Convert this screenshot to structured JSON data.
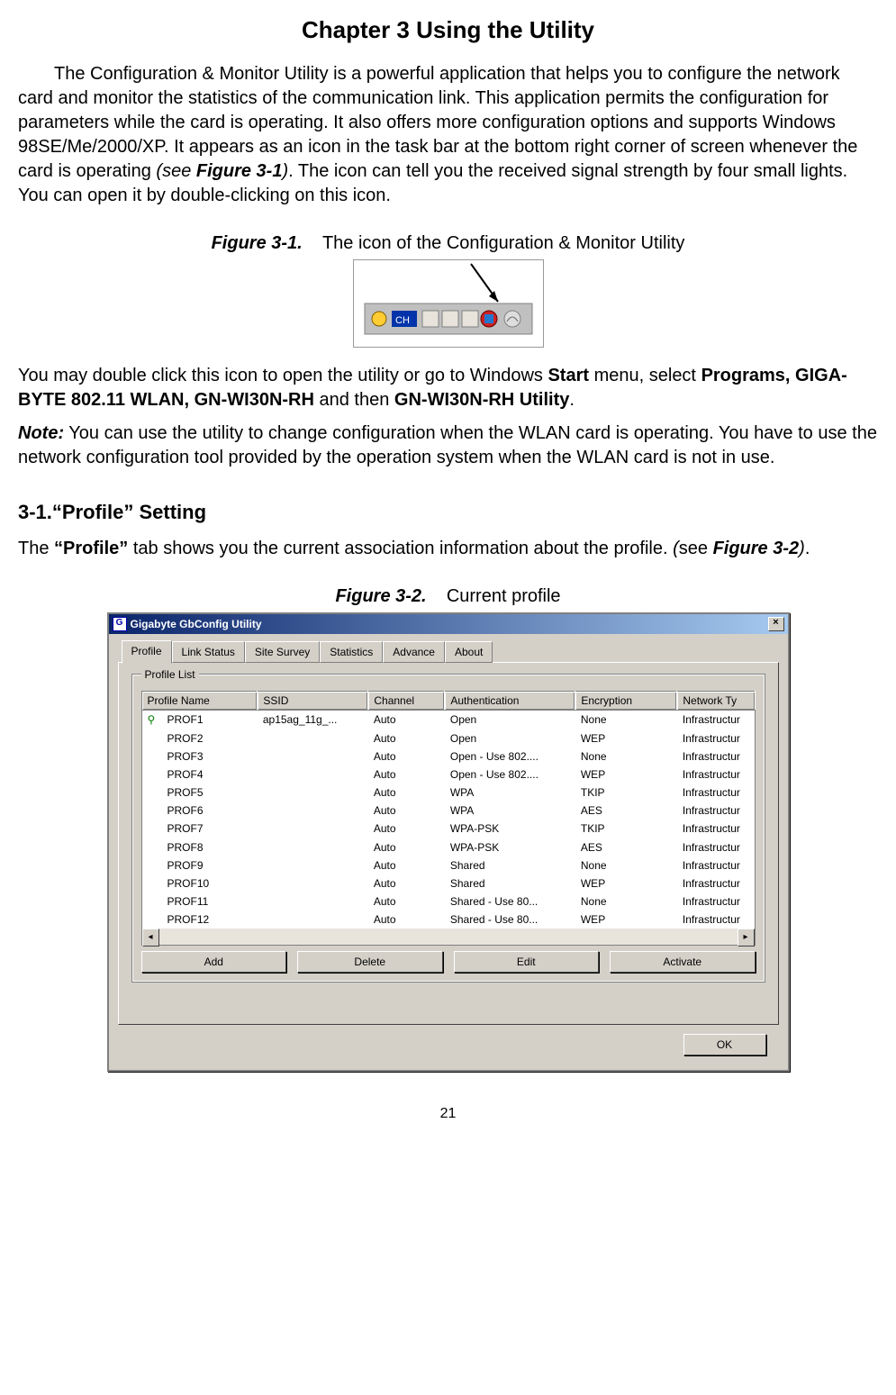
{
  "chapter_title": "Chapter 3    Using the Utility",
  "intro_p1_a": "The Configuration & Monitor Utility is a powerful application that helps you to configure the network card and monitor the statistics of the communication link. This application permits the configuration for parameters while the card is operating. It also offers more configuration options and supports Windows 98SE/Me/2000/XP. It appears as an icon in the task bar at the bottom right corner of screen whenever the card is operating ",
  "intro_see": "(see ",
  "intro_figref": "Figure 3-1",
  "intro_p1_b": "). The icon can tell you the received signal strength by four small lights. You can open it by double-clicking on this icon.",
  "fig1_label": "Figure 3-1.",
  "fig1_caption": "The icon of the Configuration & Monitor Utility",
  "after_fig_a": "You may double click this icon to open the utility or go to Windows ",
  "start_b": "Start",
  "after_fig_b": " menu, select ",
  "programs_b": "Programs, GIGA-BYTE 802.11 WLAN, GN-WI30N-RH",
  "after_fig_c": " and then ",
  "util_b": "GN-WI30N-RH Utility",
  "after_fig_d": ".",
  "note_label": "Note:",
  "note_text": " You can use the utility to change configuration when the WLAN card is operating. You have to use the network configuration tool provided by the operation system when the WLAN card is not in use.",
  "section_31": "3-1.“Profile” Setting",
  "sec_text_a": "The ",
  "sec_text_profile": "“Profile”",
  "sec_text_b": " tab shows you the current association information about the profile. ",
  "sec_see_open": "(",
  "sec_see": "see ",
  "sec_figref": "Figure 3-2",
  "sec_see_close": ")",
  "sec_text_c": ".",
  "fig2_label": "Figure 3-2.",
  "fig2_caption": "Current profile",
  "dialog": {
    "title": "Gigabyte GbConfig Utility",
    "tabs": [
      "Profile",
      "Link Status",
      "Site Survey",
      "Statistics",
      "Advance",
      "About"
    ],
    "group_label": "Profile List",
    "columns": [
      "Profile Name",
      "SSID",
      "Channel",
      "Authentication",
      "Encryption",
      "Network Ty"
    ],
    "rows": [
      {
        "active": true,
        "name": "PROF1",
        "ssid": "ap15ag_11g_...",
        "chan": "Auto",
        "auth": "Open",
        "enc": "None",
        "net": "Infrastructur"
      },
      {
        "active": false,
        "name": "PROF2",
        "ssid": "",
        "chan": "Auto",
        "auth": "Open",
        "enc": "WEP",
        "net": "Infrastructur"
      },
      {
        "active": false,
        "name": "PROF3",
        "ssid": "",
        "chan": "Auto",
        "auth": "Open - Use 802....",
        "enc": "None",
        "net": "Infrastructur"
      },
      {
        "active": false,
        "name": "PROF4",
        "ssid": "",
        "chan": "Auto",
        "auth": "Open - Use 802....",
        "enc": "WEP",
        "net": "Infrastructur"
      },
      {
        "active": false,
        "name": "PROF5",
        "ssid": "",
        "chan": "Auto",
        "auth": "WPA",
        "enc": "TKIP",
        "net": "Infrastructur"
      },
      {
        "active": false,
        "name": "PROF6",
        "ssid": "",
        "chan": "Auto",
        "auth": "WPA",
        "enc": "AES",
        "net": "Infrastructur"
      },
      {
        "active": false,
        "name": "PROF7",
        "ssid": "",
        "chan": "Auto",
        "auth": "WPA-PSK",
        "enc": "TKIP",
        "net": "Infrastructur"
      },
      {
        "active": false,
        "name": "PROF8",
        "ssid": "",
        "chan": "Auto",
        "auth": "WPA-PSK",
        "enc": "AES",
        "net": "Infrastructur"
      },
      {
        "active": false,
        "name": "PROF9",
        "ssid": "",
        "chan": "Auto",
        "auth": "Shared",
        "enc": "None",
        "net": "Infrastructur"
      },
      {
        "active": false,
        "name": "PROF10",
        "ssid": "",
        "chan": "Auto",
        "auth": "Shared",
        "enc": "WEP",
        "net": "Infrastructur"
      },
      {
        "active": false,
        "name": "PROF11",
        "ssid": "",
        "chan": "Auto",
        "auth": "Shared - Use 80...",
        "enc": "None",
        "net": "Infrastructur"
      },
      {
        "active": false,
        "name": "PROF12",
        "ssid": "",
        "chan": "Auto",
        "auth": "Shared - Use 80...",
        "enc": "WEP",
        "net": "Infrastructur"
      }
    ],
    "buttons": {
      "add": "Add",
      "delete": "Delete",
      "edit": "Edit",
      "activate": "Activate",
      "ok": "OK"
    }
  },
  "page_number": "21"
}
